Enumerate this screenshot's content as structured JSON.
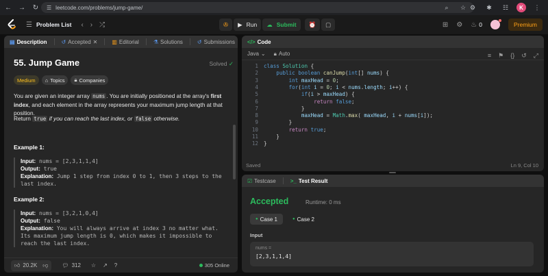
{
  "browser": {
    "url": "leetcode.com/problems/jump-game/",
    "profile_initial": "K"
  },
  "header": {
    "problem_list": "Problem List",
    "run": "Run",
    "submit": "Submit",
    "streak": "0",
    "premium": "Premium"
  },
  "left_tabs": {
    "description": "Description",
    "accepted": "Accepted",
    "editorial": "Editorial",
    "solutions": "Solutions",
    "submissions": "Submissions"
  },
  "problem": {
    "title": "55. Jump Game",
    "status": "Solved",
    "difficulty": "Medium",
    "topics": "Topics",
    "companies": "Companies",
    "para1_a": "You are given an integer array ",
    "para1_code": "nums",
    "para1_b": ". You are initially positioned at the array's ",
    "para1_bold": "first index",
    "para1_c": ", and each element in the array represents your maximum jump length at that position.",
    "para2_a": "Return ",
    "para2_true": "true",
    "para2_b": " if you can reach the last index, or ",
    "para2_false": "false",
    "para2_c": " otherwise.",
    "example1": {
      "title": "Example 1:",
      "input_label": "Input:",
      "input": " nums = [2,3,1,1,4]",
      "output_label": "Output:",
      "output": " true",
      "expl_label": "Explanation:",
      "expl_1": " Jump 1 step from index 0 to 1, then 3 steps to the",
      "expl_2": "last index."
    },
    "example2": {
      "title": "Example 2:",
      "input_label": "Input:",
      "input": " nums = [3,2,1,0,4]",
      "output_label": "Output:",
      "output": " false",
      "expl_label": "Explanation:",
      "expl_1": " You will always arrive at index 3 no matter what.",
      "expl_2": "Its maximum jump length is 0, which makes it impossible to",
      "expl_3": "reach the last index."
    }
  },
  "footer": {
    "likes": "20.2K",
    "comments": "312",
    "online": "305 Online"
  },
  "code_panel": {
    "title": "Code",
    "language": "Java",
    "mode": "Auto",
    "saved": "Saved",
    "cursor": "Ln 9, Col 10"
  },
  "code_lines": [
    {
      "n": "1",
      "text": "class Solution {"
    },
    {
      "n": "2",
      "text": "    public boolean canJump(int[] nums) {"
    },
    {
      "n": "3",
      "text": "        int maxHead = 0;"
    },
    {
      "n": "4",
      "text": "        for(int i = 0; i < nums.length; i++) {"
    },
    {
      "n": "5",
      "text": "            if(i > maxHead) {"
    },
    {
      "n": "6",
      "text": "                return false;"
    },
    {
      "n": "7",
      "text": "            }"
    },
    {
      "n": "8",
      "text": "            maxHead = Math.max( maxHead, i + nums[i]);"
    },
    {
      "n": "9",
      "text": "        }"
    },
    {
      "n": "10",
      "text": "        return true;"
    },
    {
      "n": "11",
      "text": "    }"
    },
    {
      "n": "12",
      "text": "}"
    }
  ],
  "result_panel": {
    "tab_testcase": "Testcase",
    "tab_result": "Test Result",
    "verdict": "Accepted",
    "runtime": "Runtime: 0 ms",
    "case1": "Case 1",
    "case2": "Case 2",
    "input_label": "Input",
    "var_name": "nums =",
    "var_value": "[2,3,1,1,4]"
  },
  "colors": {
    "accent_green": "#2cbb5d",
    "premium_orange": "#ffa116",
    "medium_yellow": "#ffc01e"
  }
}
